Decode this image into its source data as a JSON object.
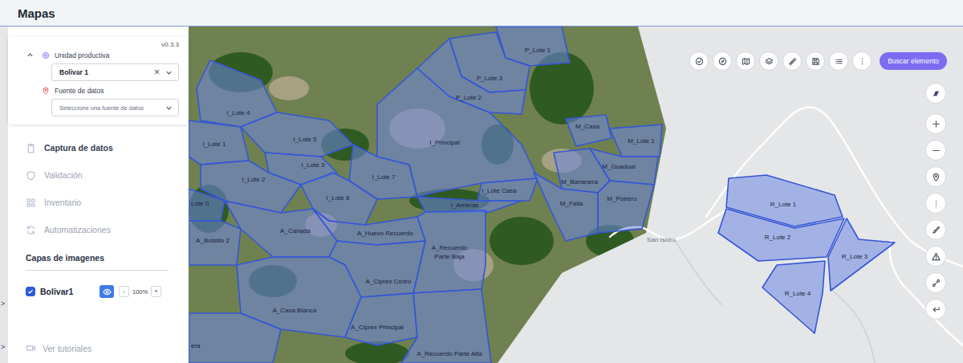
{
  "header": {
    "title": "Mapas"
  },
  "panel": {
    "version": "v0.3.3",
    "unit": {
      "label": "Unidad productiva",
      "value": "Bolivar 1",
      "clear": "×"
    },
    "source": {
      "label": "Fuente de datos",
      "placeholder": "Seleccione una fuente de datos"
    }
  },
  "nav": [
    {
      "label": "Captura de datos",
      "selected": true
    },
    {
      "label": "Validación",
      "selected": false
    },
    {
      "label": "Inventario",
      "selected": false
    },
    {
      "label": "Automatizaciones",
      "selected": false
    }
  ],
  "layers": {
    "title": "Capas de imagenes",
    "items": [
      {
        "name": "Bolivar1",
        "checked": true,
        "visible": true,
        "decrease": "-",
        "opacity": "100%",
        "increase": "+"
      }
    ]
  },
  "tutorials": {
    "label": "Ver tutoriales"
  },
  "search_button": {
    "label": "Buscar elemento"
  },
  "edge_markers": [
    ">",
    ">"
  ],
  "map": {
    "places": [
      {
        "name": "San Isidro"
      }
    ],
    "lots": [
      {
        "lines": [
          "I_Lote 4"
        ]
      },
      {
        "lines": [
          "I_Lote 1"
        ]
      },
      {
        "lines": [
          "I_Lote 5"
        ]
      },
      {
        "lines": [
          "I_Lote 3"
        ]
      },
      {
        "lines": [
          "I_Lote 2"
        ]
      },
      {
        "lines": [
          "I_Lote 7"
        ]
      },
      {
        "lines": [
          "I_Lote 6"
        ]
      },
      {
        "lines": [
          "I_Principal"
        ]
      },
      {
        "lines": [
          "I_Lote Casa"
        ]
      },
      {
        "lines": [
          "I_Arrieras"
        ]
      },
      {
        "lines": [
          "P_Lote 1"
        ]
      },
      {
        "lines": [
          "P_Lote 3"
        ]
      },
      {
        "lines": [
          "P_Lote 2"
        ]
      },
      {
        "lines": [
          "M_Casa"
        ]
      },
      {
        "lines": [
          "M_Lote 1"
        ]
      },
      {
        "lines": [
          "M_Guadual"
        ]
      },
      {
        "lines": [
          "M_Bananera"
        ]
      },
      {
        "lines": [
          "M_Potrero"
        ]
      },
      {
        "lines": [
          "M_Falla"
        ]
      },
      {
        "lines": [
          "Lote 0"
        ]
      },
      {
        "lines": [
          "A_Bolsillo 2"
        ]
      },
      {
        "lines": [
          "A_Canada"
        ]
      },
      {
        "lines": [
          "A_Huevo Recuerdo"
        ]
      },
      {
        "lines": [
          "A_Recuerdo",
          "Parte Baja"
        ]
      },
      {
        "lines": [
          "A_Ciprex Cedro"
        ]
      },
      {
        "lines": [
          "A_Casa Blanca"
        ]
      },
      {
        "lines": [
          "A_Ciprex Principal"
        ]
      },
      {
        "lines": [
          "A_Recuerdo Parte Alta"
        ]
      },
      {
        "lines": [
          "era"
        ]
      },
      {
        "lines": [
          "R_Lote 1"
        ]
      },
      {
        "lines": [
          "R_Lote 2"
        ]
      },
      {
        "lines": [
          "R_Lote 3"
        ]
      },
      {
        "lines": [
          "R_Lote 4"
        ]
      }
    ]
  }
}
